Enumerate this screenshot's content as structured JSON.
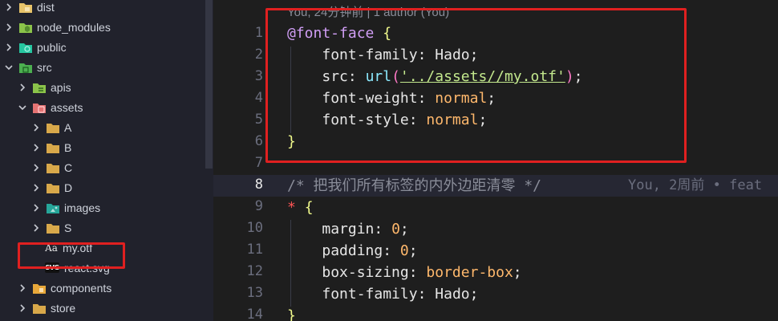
{
  "explorer": {
    "items": [
      {
        "label": "dist",
        "chevron": "right",
        "icon": "folder-dist-icon",
        "color": "#e8c46a"
      },
      {
        "label": "node_modules",
        "chevron": "right",
        "icon": "folder-node-icon",
        "color": "#8bc34a"
      },
      {
        "label": "public",
        "chevron": "right",
        "icon": "folder-public-icon",
        "color": "#26c6a0"
      },
      {
        "label": "src",
        "chevron": "down",
        "icon": "folder-src-icon",
        "color": "#4caf50"
      },
      {
        "label": "apis",
        "chevron": "right",
        "icon": "folder-apis-icon",
        "color": "#8bc34a"
      },
      {
        "label": "assets",
        "chevron": "down",
        "icon": "folder-assets-icon",
        "color": "#e57373"
      },
      {
        "label": "A",
        "chevron": "right",
        "icon": "folder-icon",
        "color": "#d8a84a"
      },
      {
        "label": "B",
        "chevron": "right",
        "icon": "folder-icon",
        "color": "#d8a84a"
      },
      {
        "label": "C",
        "chevron": "right",
        "icon": "folder-icon",
        "color": "#d8a84a"
      },
      {
        "label": "D",
        "chevron": "right",
        "icon": "folder-icon",
        "color": "#d8a84a"
      },
      {
        "label": "images",
        "chevron": "right",
        "icon": "folder-images-icon",
        "color": "#26a69a"
      },
      {
        "label": "S",
        "chevron": "right",
        "icon": "folder-icon",
        "color": "#d8a84a"
      },
      {
        "label": "my.otf",
        "chevron": "none",
        "icon": "font-file-icon",
        "glyph": "Aa"
      },
      {
        "label": "react.svg",
        "chevron": "none",
        "icon": "svg-file-icon",
        "glyph": "SVG"
      },
      {
        "label": "components",
        "chevron": "right",
        "icon": "folder-components-icon",
        "color": "#e8a83a"
      },
      {
        "label": "store",
        "chevron": "right",
        "icon": "folder-store-icon",
        "color": "#d8a84a"
      }
    ]
  },
  "editor": {
    "blame_top": "You, 24分钟前 | 1 author (You)",
    "blame_inline": "You, 2周前 • feat",
    "line_numbers": [
      "1",
      "2",
      "3",
      "4",
      "5",
      "6",
      "7",
      "8",
      "9",
      "10",
      "11",
      "12",
      "13",
      "14"
    ],
    "active_line": "8",
    "code": {
      "l1": {
        "at": "@font-face",
        "brace": "{"
      },
      "l2": {
        "prop": "font-family",
        "value": "Hado"
      },
      "l3": {
        "prop": "src",
        "fn": "url",
        "str": "'../assets//my.otf'"
      },
      "l4": {
        "prop": "font-weight",
        "value": "normal"
      },
      "l5": {
        "prop": "font-style",
        "value": "normal"
      },
      "l6": {
        "brace": "}"
      },
      "l8": {
        "comment": "/* 把我们所有标签的内外边距清零 */"
      },
      "l9": {
        "sel": "*",
        "brace": "{"
      },
      "l10": {
        "prop": "margin",
        "value": "0"
      },
      "l11": {
        "prop": "padding",
        "value": "0"
      },
      "l12": {
        "prop": "box-sizing",
        "value": "border-box"
      },
      "l13": {
        "prop": "font-family",
        "value": "Hado"
      },
      "l14": {
        "brace": "}"
      }
    }
  },
  "colors": {
    "highlight_frame": "#e02020",
    "sidebar_bg": "#21222c",
    "editor_bg": "#1e1e1e"
  }
}
